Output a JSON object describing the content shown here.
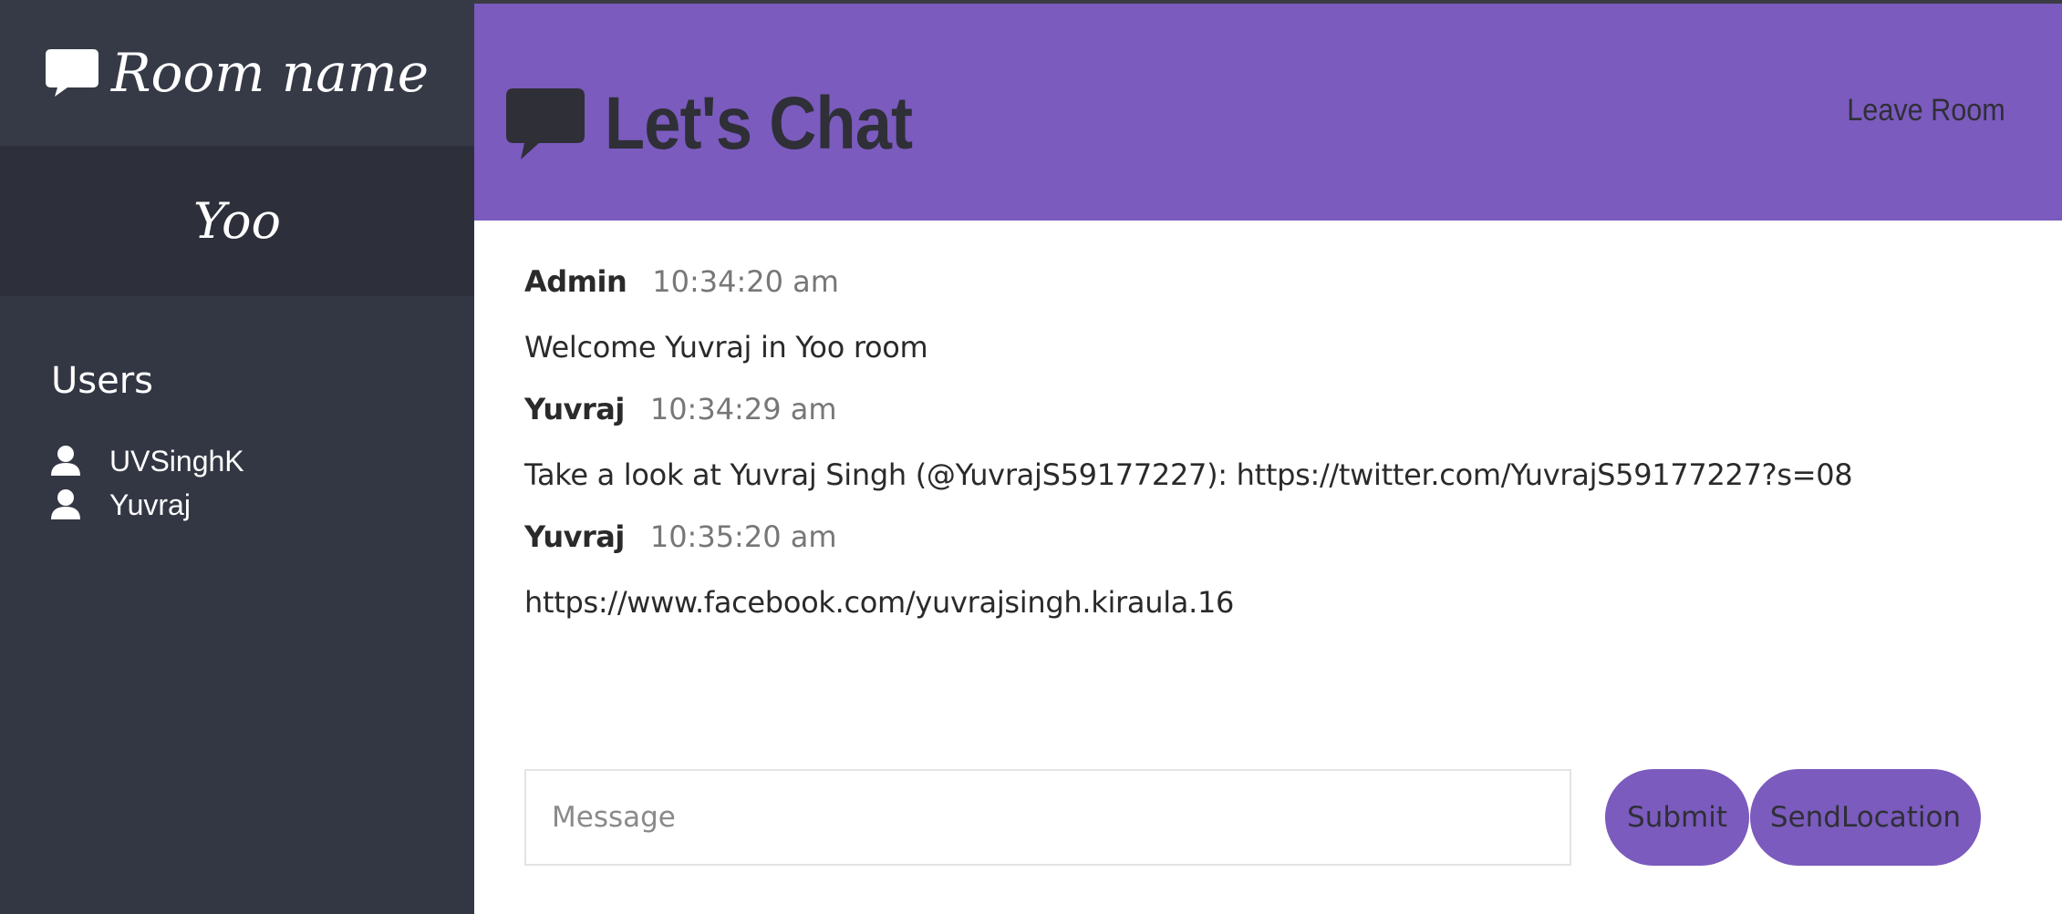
{
  "sidebar": {
    "title": "Room name",
    "room": "Yoo",
    "users_heading": "Users",
    "users": [
      {
        "name": "UVSinghK"
      },
      {
        "name": "Yuvraj"
      }
    ]
  },
  "header": {
    "title": "Let's Chat",
    "leave_label": "Leave Room"
  },
  "messages": [
    {
      "author": "Admin",
      "time": "10:34:20 am",
      "text": "Welcome Yuvraj in Yoo room"
    },
    {
      "author": "Yuvraj",
      "time": "10:34:29 am",
      "text": "Take a look at Yuvraj Singh (@YuvrajS59177227): https://twitter.com/YuvrajS59177227?s=08"
    },
    {
      "author": "Yuvraj",
      "time": "10:35:20 am",
      "text": "https://www.facebook.com/yuvrajsingh.kiraula.16"
    }
  ],
  "compose": {
    "placeholder": "Message",
    "value": "",
    "submit_label": "Submit",
    "location_label": "SendLocation"
  },
  "colors": {
    "accent": "#7b5bbe",
    "sidebar_bg": "#333744",
    "sidebar_room_bg": "#2d303b",
    "text_dark": "#2f2f37"
  },
  "icons": {
    "sidebar_title": "chat-bubble-icon",
    "header_title": "chat-bubble-icon",
    "user": "user-icon"
  }
}
